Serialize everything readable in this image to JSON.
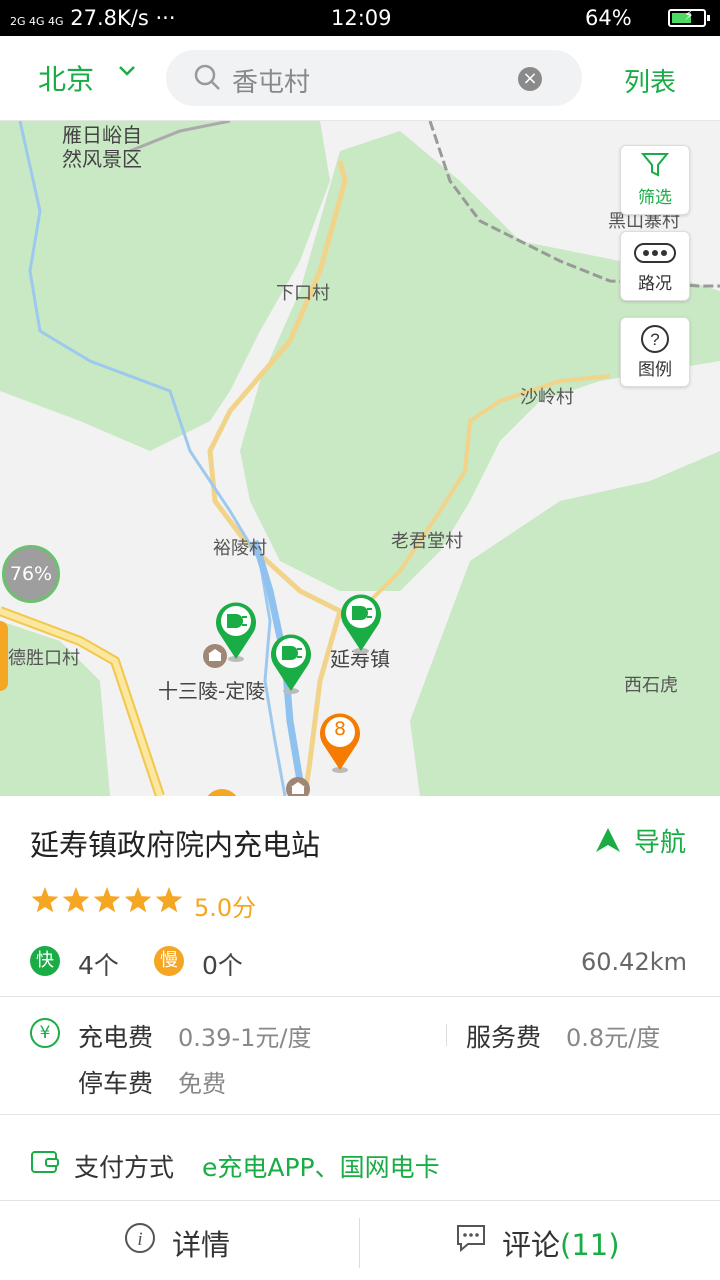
{
  "status_bar": {
    "signal": "2G 4G 4G",
    "speed": "27.8K/s ···",
    "time": "12:09",
    "battery": "64%",
    "battery_level": 0.64
  },
  "top_bar": {
    "city": "北京",
    "search_value": "香屯村",
    "list_button": "列表"
  },
  "map": {
    "controls": {
      "filter": "筛选",
      "traffic": "路况",
      "legend": "图例"
    },
    "labels": {
      "scenic": "雁翅峪自然风景区",
      "scenic_line1": "雁日峪自",
      "scenic_line2": "然风景区",
      "heishanzhai": "黑山寨村",
      "xiakou": "下口村",
      "shaling": "沙岭村",
      "yuling": "裕陵村",
      "laojuntang": "老君堂村",
      "desheng": "德胜口村",
      "shisanling": "十三陵-定陵",
      "yanshou": "延寿镇",
      "xishihu": "西石虎"
    },
    "cluster_label": "76%",
    "orange_pin_number": "8",
    "colors": {
      "green_area": "#c9e8c4",
      "road": "#f7d98a",
      "pin_green": "#1aac45",
      "pin_orange": "#f57c00"
    }
  },
  "station": {
    "name": "延寿镇政府院内充电站",
    "nav_label": "导航",
    "rating": "5.0分",
    "stars": 5,
    "fast_badge": "快",
    "fast_count": "4个",
    "slow_badge": "慢",
    "slow_count": "0个",
    "distance": "60.42km",
    "charge_fee_label": "充电费",
    "charge_fee_value": "0.39-1元/度",
    "service_fee_label": "服务费",
    "service_fee_value": "0.8元/度",
    "parking_fee_label": "停车费",
    "parking_fee_value": "免费",
    "payment_label": "支付方式",
    "payment_value": "e充电APP、国网电卡"
  },
  "bottom_bar": {
    "details": "详情",
    "comments": "评论",
    "comments_count": "(11)"
  }
}
